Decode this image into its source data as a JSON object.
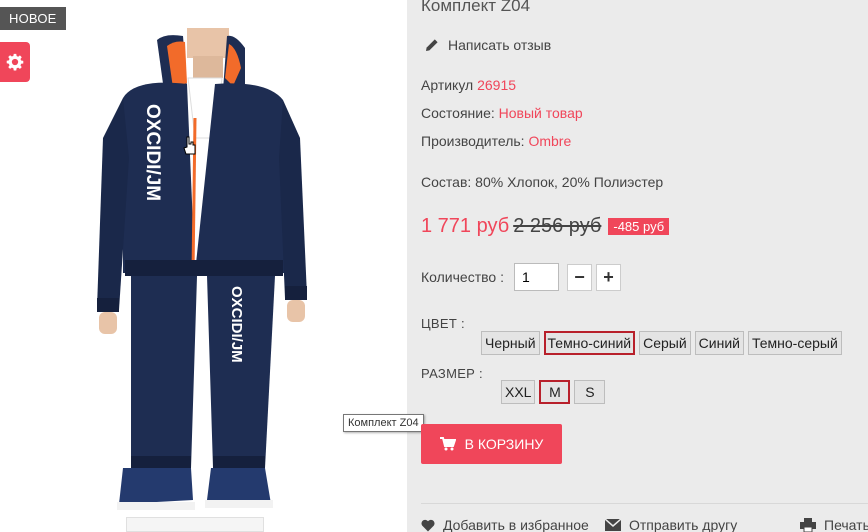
{
  "badge": {
    "label": "НОВОЕ"
  },
  "tooltip": {
    "text": "Комплект Z04"
  },
  "product": {
    "title": "Комплект Z04",
    "review_link": "Написать отзыв",
    "sku_label": "Артикул",
    "sku_value": "26915",
    "condition_label": "Состояние:",
    "condition_value": "Новый товар",
    "maker_label": "Производитель:",
    "maker_value": "Ombre",
    "composition": "Состав: 80% Хлопок, 20% Полиэстер",
    "brand_print": "OXCIDI/JM"
  },
  "price": {
    "current": "1 771 руб",
    "old": "2 256 руб",
    "discount": "-485 руб"
  },
  "quantity": {
    "label": "Количество :",
    "value": "1",
    "minus": "−",
    "plus": "+"
  },
  "color": {
    "label": "ЦВЕТ :",
    "options": [
      "Черный",
      "Темно-синий",
      "Серый",
      "Синий",
      "Темно-серый"
    ],
    "selected": "Темно-синий"
  },
  "size": {
    "label": "РАЗМЕР :",
    "options": [
      "XXL",
      "M",
      "S"
    ],
    "selected": "M"
  },
  "cart": {
    "label": "В КОРЗИНУ"
  },
  "bottom_links": {
    "favorites": "Добавить в избранное",
    "send_friend": "Отправить другу",
    "print": "Печать"
  },
  "colors": {
    "accent": "#f0465a",
    "selected_border": "#b8202b",
    "garment": "#1e2d52",
    "trim": "#f26b2a"
  }
}
